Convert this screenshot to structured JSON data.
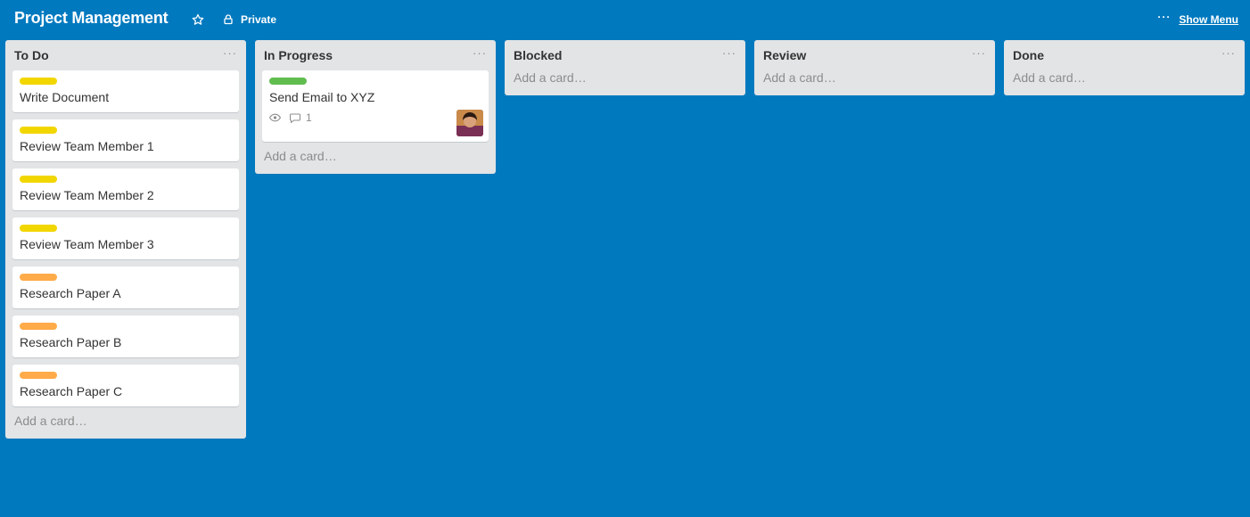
{
  "board": {
    "title": "Project Management",
    "privacy_label": "Private",
    "menu_label": "Show Menu",
    "menu_dots": "···"
  },
  "colors": {
    "background": "#0079BF",
    "list_bg": "#E2E4E6",
    "label_yellow": "#F2D600",
    "label_orange": "#FFAB4A",
    "label_green": "#61BD4F"
  },
  "lists": [
    {
      "title": "To Do",
      "menu": "···",
      "add_card": "Add a card…",
      "cards": [
        {
          "title": "Write Document",
          "label_color": "#F2D600"
        },
        {
          "title": "Review Team Member 1",
          "label_color": "#F2D600"
        },
        {
          "title": "Review Team Member 2",
          "label_color": "#F2D600"
        },
        {
          "title": "Review Team Member 3",
          "label_color": "#F2D600"
        },
        {
          "title": "Research Paper A",
          "label_color": "#FFAB4A"
        },
        {
          "title": "Research Paper B",
          "label_color": "#FFAB4A"
        },
        {
          "title": "Research Paper C",
          "label_color": "#FFAB4A"
        }
      ]
    },
    {
      "title": "In Progress",
      "menu": "···",
      "add_card": "Add a card…",
      "cards": [
        {
          "title": "Send Email to XYZ",
          "label_color": "#61BD4F",
          "watching": true,
          "comments": "1",
          "member_avatar": true
        }
      ]
    },
    {
      "title": "Blocked",
      "menu": "···",
      "add_card": "Add a card…",
      "cards": []
    },
    {
      "title": "Review",
      "menu": "···",
      "add_card": "Add a card…",
      "cards": []
    },
    {
      "title": "Done",
      "menu": "···",
      "add_card": "Add a card…",
      "cards": []
    }
  ]
}
